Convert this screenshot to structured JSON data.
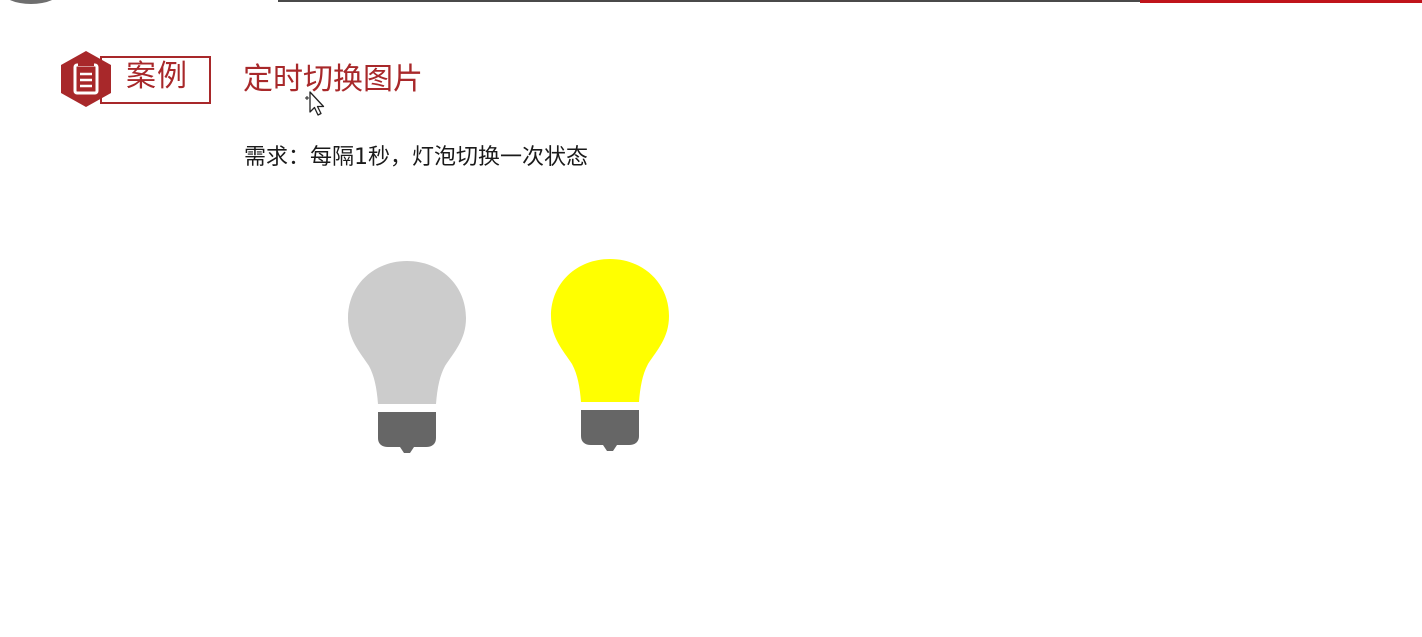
{
  "header": {
    "case_label": "案例",
    "title": "定时切换图片"
  },
  "content": {
    "requirement": "需求：每隔1秒，灯泡切换一次状态"
  },
  "bulbs": [
    {
      "state": "off",
      "color": "#cccccc",
      "base_color": "#666666"
    },
    {
      "state": "on",
      "color": "#ffff00",
      "base_color": "#666666"
    }
  ],
  "colors": {
    "accent": "#a8282a",
    "top_bar_red": "#c0141b"
  }
}
